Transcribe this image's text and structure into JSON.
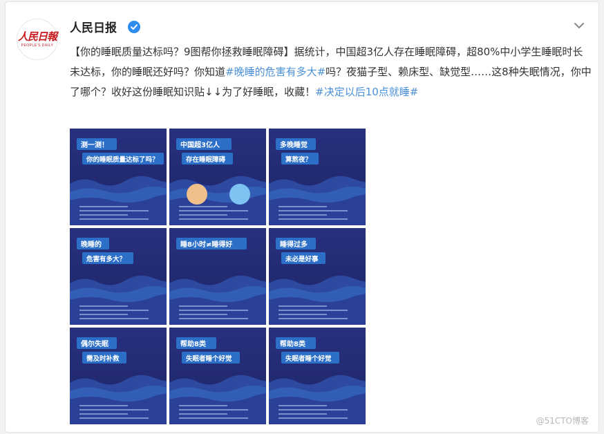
{
  "account": {
    "name": "人民日报",
    "avatar_cn": "人民日報",
    "avatar_en": "PEOPLE'S DAILY"
  },
  "post": {
    "t1": "【你的睡眠质量达标吗？9图帮你拯救睡眠障碍】据统计，中国超3亿人存在睡眠障碍，超80%中小学生睡眠时长未达标，你的睡眠还好吗？你知道",
    "topic1": "#晚睡的危害有多大#",
    "t2": "吗？夜猫子型、赖床型、缺觉型……这8种失眠情况，你中了哪个？收好这份睡眠知识贴↓↓为了好睡眠，收藏！",
    "topic2": "#决定以后10点就睡#"
  },
  "images": [
    {
      "title1": "测一测！",
      "title2": "你的睡眠质量达标了吗？"
    },
    {
      "title1": "中国超3亿人",
      "title2": "存在睡眠障碍"
    },
    {
      "title1": "多晚睡觉",
      "title2": "算熬夜？"
    },
    {
      "title1": "晚睡的",
      "title2": "危害有多大？"
    },
    {
      "title1": "睡8小时≠睡得好",
      "title2": ""
    },
    {
      "title1": "睡得过多",
      "title2": "未必是好事"
    },
    {
      "title1": "偶尔失眠",
      "title2": "需及时补救"
    },
    {
      "title1": "帮助8类",
      "title2": "失眠者睡个好觉"
    },
    {
      "title1": "帮助8类",
      "title2": "失眠者睡个好觉"
    }
  ],
  "watermark": "@51CTO博客",
  "colors": {
    "topic": "#4a90d9",
    "verified": "#2d8cf0",
    "tile_bg": "#232a78",
    "banner": "#2c6fc9"
  },
  "icons": {
    "verified": "verified-badge-icon",
    "menu": "chevron-down-icon"
  }
}
